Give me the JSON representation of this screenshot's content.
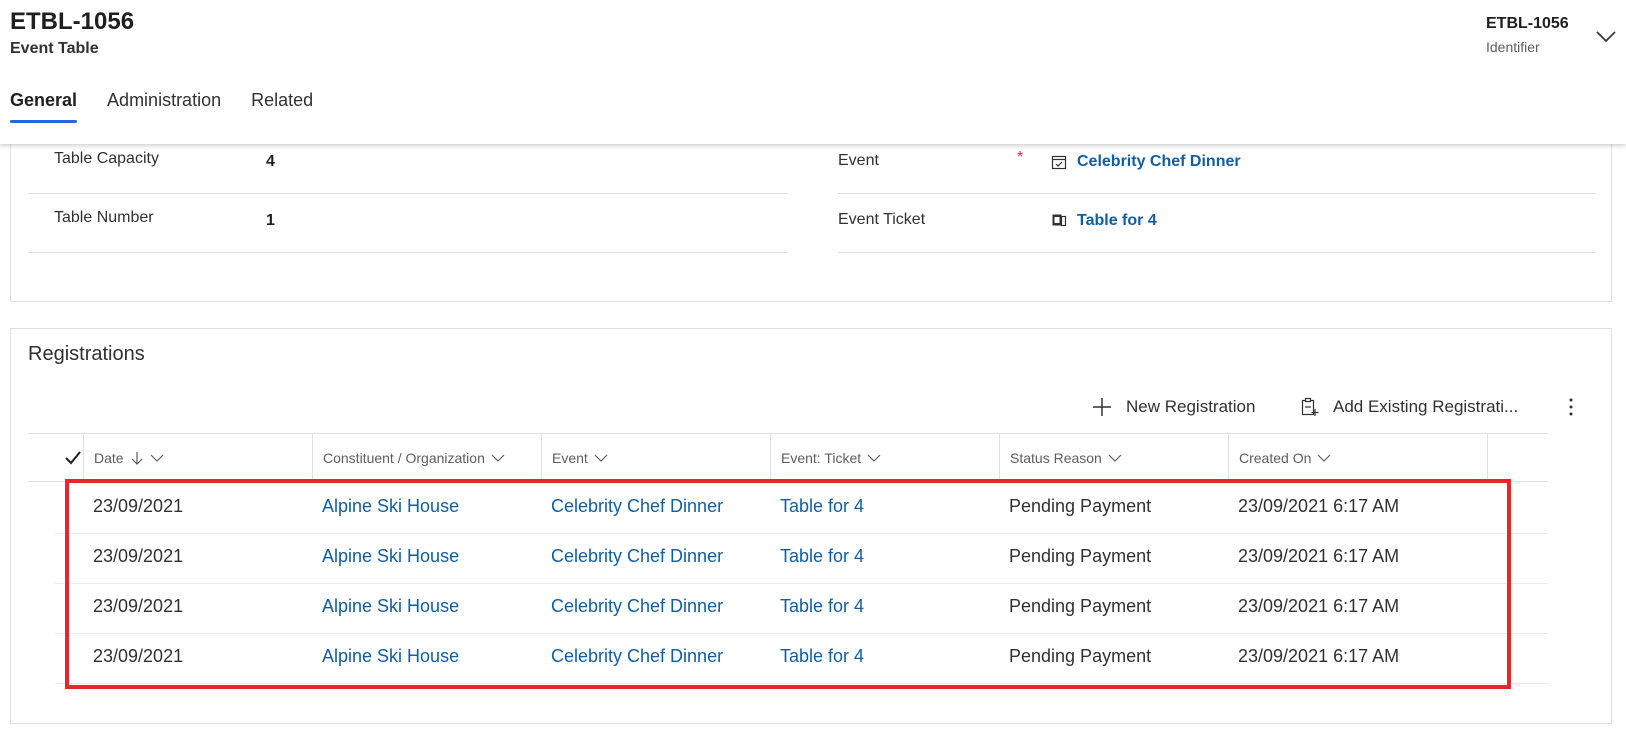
{
  "header": {
    "title": "ETBL-1056",
    "subtitle": "Event Table",
    "field_value": "ETBL-1056",
    "field_label": "Identifier"
  },
  "tabs": [
    {
      "label": "General",
      "active": true
    },
    {
      "label": "Administration",
      "active": false
    },
    {
      "label": "Related",
      "active": false
    }
  ],
  "fields": {
    "table_capacity": {
      "label": "Table Capacity",
      "value": "4"
    },
    "table_number": {
      "label": "Table Number",
      "value": "1"
    },
    "event": {
      "label": "Event",
      "required": "*",
      "value": "Celebrity Chef Dinner"
    },
    "event_ticket": {
      "label": "Event Ticket",
      "value": "Table for 4"
    }
  },
  "registrations": {
    "title": "Registrations",
    "commands": {
      "new": "New Registration",
      "add_existing": "Add Existing Registrati..."
    },
    "columns": [
      "Date",
      "Constituent / Organization",
      "Event",
      "Event: Ticket",
      "Status Reason",
      "Created On"
    ],
    "rows": [
      [
        "23/09/2021",
        "Alpine Ski House",
        "Celebrity Chef Dinner",
        "Table for 4",
        "Pending Payment",
        "23/09/2021 6:17 AM"
      ],
      [
        "23/09/2021",
        "Alpine Ski House",
        "Celebrity Chef Dinner",
        "Table for 4",
        "Pending Payment",
        "23/09/2021 6:17 AM"
      ],
      [
        "23/09/2021",
        "Alpine Ski House",
        "Celebrity Chef Dinner",
        "Table for 4",
        "Pending Payment",
        "23/09/2021 6:17 AM"
      ],
      [
        "23/09/2021",
        "Alpine Ski House",
        "Celebrity Chef Dinner",
        "Table for 4",
        "Pending Payment",
        "23/09/2021 6:17 AM"
      ]
    ]
  },
  "colors": {
    "accent": "#2266e3",
    "link": "#115ea3",
    "highlight": "#e8262a",
    "required": "#d13438"
  }
}
